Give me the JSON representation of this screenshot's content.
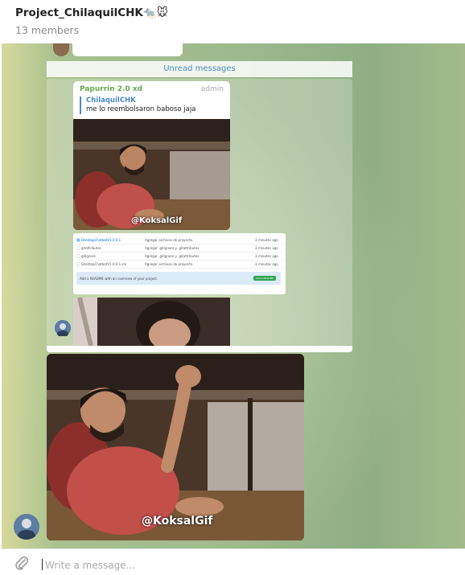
{
  "header": {
    "title": "Project_ChilaquilCHK",
    "title_emojis": "🐀🐭",
    "members": "13 members"
  },
  "chat": {
    "unread_label": "Unread messages",
    "message": {
      "sender": "Papurrin 2.0 xd",
      "role": "admin",
      "reply_name": "ChilaquilCHK",
      "reply_text": "me lo reembolsaron baboso jaja",
      "gif_watermark": "@KoksalGif"
    },
    "github_card": {
      "rows": [
        {
          "name": "DesktopChatbotV1.0.0.1",
          "message": "Agregar archivos de proyecto.",
          "time": "3 minutes ago"
        },
        {
          "name": "gitattributes",
          "message": "Agregar .gitignore y .gitattributes.",
          "time": "3 minutes ago"
        },
        {
          "name": "gitignore",
          "message": "Agregar .gitignore y .gitattributes.",
          "time": "3 minutes ago"
        },
        {
          "name": "DesktopChatbotV1.0.0.1.sln",
          "message": "Agregar archivos de proyecto.",
          "time": "3 minutes ago"
        }
      ],
      "readme_text": "Add a README with an overview of your project.",
      "readme_button": "Add a README"
    },
    "gif2_watermark": "@KoksalGif"
  },
  "composer": {
    "placeholder": "Write a message..."
  },
  "colors": {
    "accent_blue": "#4a8cc2",
    "sender_green": "#6aa84f",
    "github_green": "#2ea44f"
  }
}
